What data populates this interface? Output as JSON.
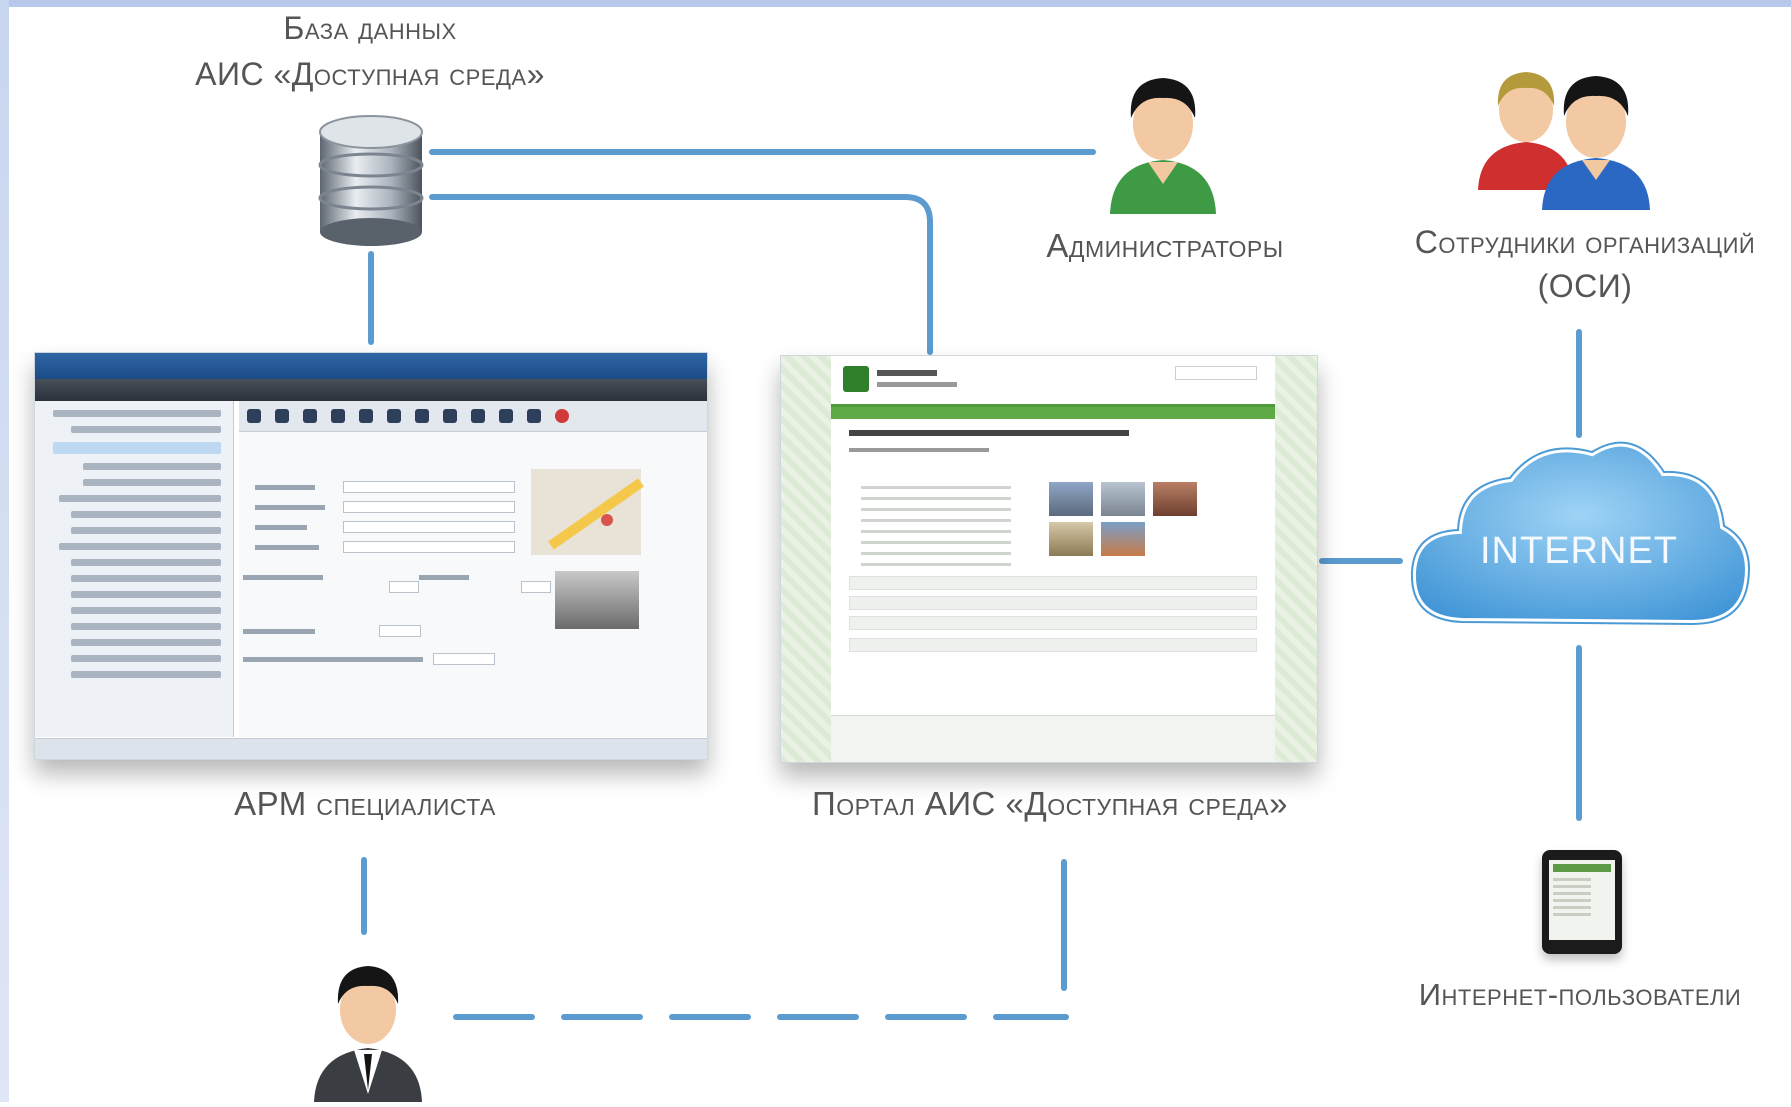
{
  "database": {
    "label_line1": "База данных",
    "label_line2": "АИС «Доступная среда»"
  },
  "admins": {
    "label": "Администраторы"
  },
  "org_staff": {
    "label_line1": "Сотрудники организаций",
    "label_line2": "(ОСИ)"
  },
  "apm": {
    "label": "АРМ специалиста"
  },
  "portal": {
    "label": "Портал АИС «Доступная среда»"
  },
  "internet": {
    "label": "INTERNET"
  },
  "internet_users": {
    "label": "Интернет-пользователи"
  },
  "colors": {
    "connector": "#5b9bd0",
    "cloud": "#69b3e6",
    "label_text": "#555555"
  },
  "icons": [
    "database-icon",
    "administrator-user-icon",
    "organization-staff-users-icon",
    "internet-cloud-icon",
    "tablet-icon",
    "specialist-user-icon"
  ]
}
